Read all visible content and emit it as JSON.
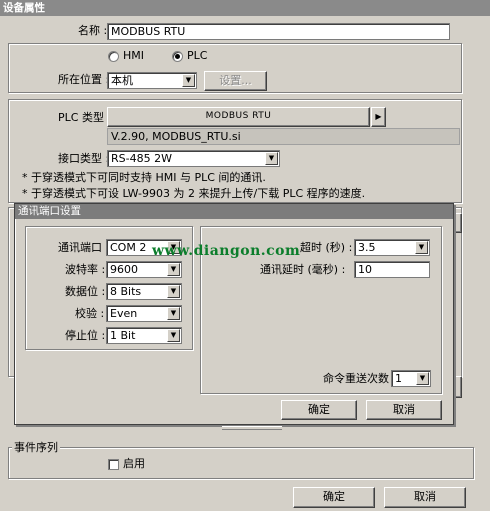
{
  "window": {
    "title": "设备属性"
  },
  "device": {
    "name_label": "名称 :",
    "name_value": "MODBUS RTU",
    "radio_hmi": "HMI",
    "radio_plc": "PLC",
    "selected": "PLC",
    "location_label": "所在位置 :",
    "location_value": "本机",
    "settings_button": "设置..."
  },
  "plc": {
    "type_label": "PLC 类型 :",
    "type_value": "MODBUS RTU",
    "version": "V.2.90, MODBUS_RTU.si",
    "interface_label": "接口类型 :",
    "interface_value": "RS-485 2W",
    "note1": "* 于穿透模式下可同时支持 HMI 与 PLC 间的通讯.",
    "note2": "* 于穿透模式下可设 LW-9903 为 2 来提升上传/下载 PLC 程序的速度."
  },
  "comm_dialog": {
    "title": "通讯端口设置",
    "port_label": "通讯端口 :",
    "port_value": "COM 2",
    "baud_label": "波特率 :",
    "baud_value": "9600",
    "databits_label": "数据位 :",
    "databits_value": "8 Bits",
    "parity_label": "校验 :",
    "parity_value": "Even",
    "stopbits_label": "停止位 :",
    "stopbits_value": "1 Bit",
    "timeout_label": "超时 (秒) :",
    "timeout_value": "3.5",
    "delay_label": "通讯延时 (毫秒) :",
    "delay_value": "10",
    "retry_label": "命令重送次数 :",
    "retry_value": "1",
    "ok": "确定",
    "cancel": "取消"
  },
  "event": {
    "group_label": "事件序列",
    "enable_label": "启用"
  },
  "footer": {
    "ok": "确定",
    "cancel": "取消"
  },
  "watermark": "www.diangon.com"
}
